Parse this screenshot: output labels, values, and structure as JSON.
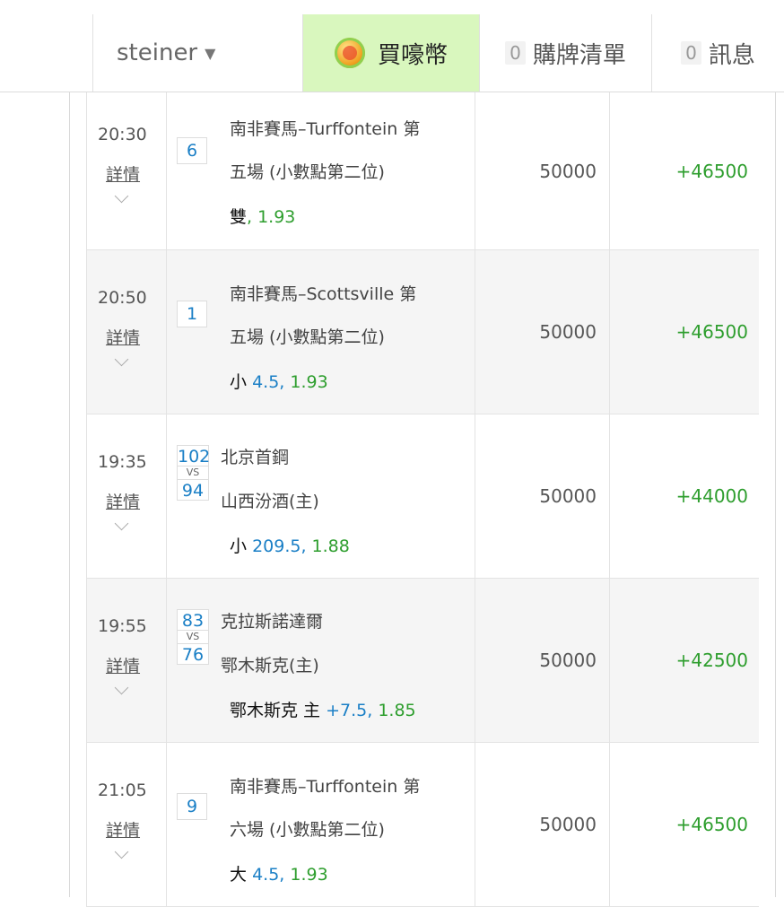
{
  "header": {
    "user": "steiner",
    "buy_coins": "買嚎幣",
    "cart_count": "0",
    "cart_label": "購牌清單",
    "msg_count": "0",
    "msg_label": "訊息"
  },
  "bets": [
    {
      "time": "20:30",
      "detail": "詳情",
      "code": "6",
      "title1": "南非賽馬–Turffontein 第",
      "title2": "五場 (小數點第二位)",
      "pick": "雙",
      "line": "",
      "odds": ", 1.93",
      "stake": "50000",
      "win": "+46500"
    },
    {
      "time": "20:50",
      "detail": "詳情",
      "code": "1",
      "title1": "南非賽馬–Scottsville 第",
      "title2": "五場 (小數點第二位)",
      "pick": "小",
      "line": "4.5,",
      "odds": "1.93",
      "stake": "50000",
      "win": "+46500"
    },
    {
      "time": "19:35",
      "detail": "詳情",
      "score_a": "102",
      "vs": "VS",
      "score_b": "94",
      "title1": "北京首鋼",
      "title2": "山西汾酒(主)",
      "pick": "小",
      "line": "209.5,",
      "odds": "1.88",
      "stake": "50000",
      "win": "+44000"
    },
    {
      "time": "19:55",
      "detail": "詳情",
      "score_a": "83",
      "vs": "VS",
      "score_b": "76",
      "title1": "克拉斯諾達爾",
      "title2": "鄂木斯克(主)",
      "pick": "鄂木斯克 主",
      "line": "+7.5,",
      "odds": "1.85",
      "stake": "50000",
      "win": "+42500"
    },
    {
      "time": "21:05",
      "detail": "詳情",
      "code": "9",
      "title1": "南非賽馬–Turffontein 第",
      "title2": "六場 (小數點第二位)",
      "pick": "大",
      "line": "4.5,",
      "odds": "1.93",
      "stake": "50000",
      "win": "+46500"
    }
  ]
}
